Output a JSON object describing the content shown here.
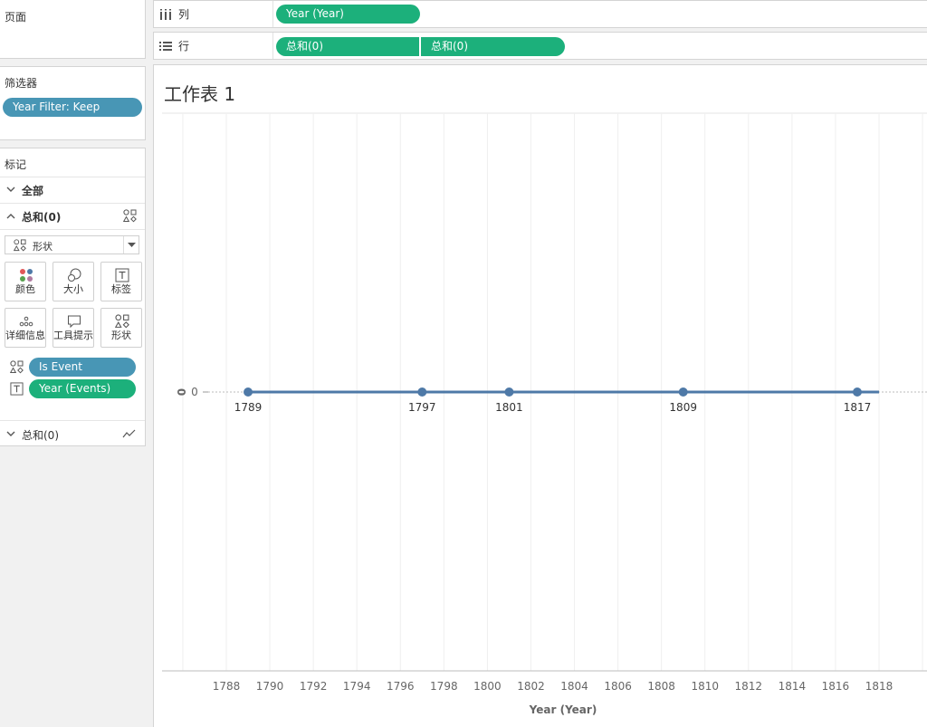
{
  "pages_panel": {
    "title": "页面"
  },
  "filters_panel": {
    "title": "筛选器",
    "pills": [
      {
        "label": "Year Filter: Keep"
      }
    ]
  },
  "marks_panel": {
    "title": "标记",
    "all_label": "全部",
    "sum_section": {
      "label": "总和(0)",
      "mark_type": "形状"
    },
    "buttons": [
      {
        "label": "颜色",
        "icon": "color-icon"
      },
      {
        "label": "大小",
        "icon": "size-icon"
      },
      {
        "label": "标签",
        "icon": "label-icon"
      },
      {
        "label": "详细信息",
        "icon": "detail-icon"
      },
      {
        "label": "工具提示",
        "icon": "tooltip-icon"
      },
      {
        "label": "形状",
        "icon": "shape-icon"
      }
    ],
    "encodings": [
      {
        "label": "Is Event",
        "icon": "shape-icon",
        "color": "#4896b5"
      },
      {
        "label": "Year (Events)",
        "icon": "label-icon",
        "color": "#1cb07b"
      }
    ],
    "sum_section_2": {
      "label": "总和(0)"
    }
  },
  "columns_shelf": {
    "label": "列",
    "pills": [
      {
        "label": "Year (Year)"
      }
    ]
  },
  "rows_shelf": {
    "label": "行",
    "pills": [
      {
        "label": "总和(0)"
      },
      {
        "label": "总和(0)"
      }
    ]
  },
  "sheet": {
    "title": "工作表 1"
  },
  "colors": {
    "accent_green": "#1cb07b",
    "accent_blue": "#4896b5",
    "mark": "#4e79a7"
  },
  "chart_data": {
    "type": "line",
    "title": "工作表 1",
    "xlabel": "Year (Year)",
    "ylabel": "0",
    "xlim": [
      1786,
      1820
    ],
    "x_ticks": [
      1788,
      1790,
      1792,
      1794,
      1796,
      1798,
      1800,
      1802,
      1804,
      1806,
      1808,
      1810,
      1812,
      1814,
      1816,
      1818
    ],
    "y_ticks": [
      0
    ],
    "line": {
      "x_start": 1789,
      "x_end": 1818,
      "y": 0
    },
    "points": [
      {
        "x": 1789,
        "y": 0,
        "label": "1789"
      },
      {
        "x": 1797,
        "y": 0,
        "label": "1797"
      },
      {
        "x": 1801,
        "y": 0,
        "label": "1801"
      },
      {
        "x": 1809,
        "y": 0,
        "label": "1809"
      },
      {
        "x": 1817,
        "y": 0,
        "label": "1817"
      }
    ],
    "grid": true
  }
}
